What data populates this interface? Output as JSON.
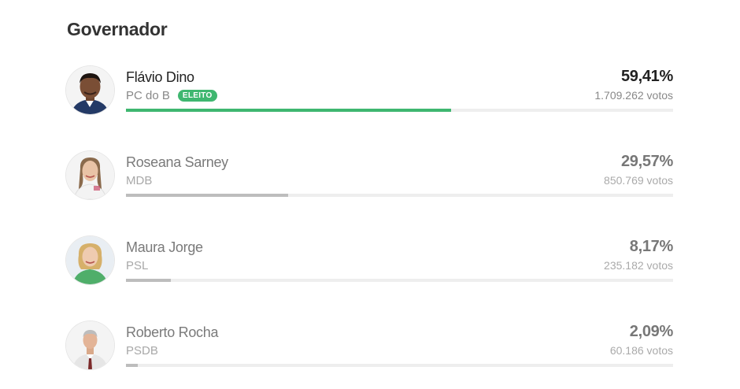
{
  "section_title": "Governador",
  "candidates": [
    {
      "name": "Flávio Dino",
      "party": "PC do B",
      "badge": "ELEITO",
      "percent": "59,41%",
      "votes": "1.709.262 votos",
      "share": 0.5941
    },
    {
      "name": "Roseana Sarney",
      "party": "MDB",
      "percent": "29,57%",
      "votes": "850.769 votos",
      "share": 0.2957
    },
    {
      "name": "Maura Jorge",
      "party": "PSL",
      "percent": "8,17%",
      "votes": "235.182 votos",
      "share": 0.0817
    },
    {
      "name": "Roberto Rocha",
      "party": "PSDB",
      "percent": "2,09%",
      "votes": "60.186 votos",
      "share": 0.0209
    }
  ],
  "colors": {
    "winner_bar": "#3fb770",
    "bar": "#bdbdbd",
    "track": "#eeeeee"
  }
}
